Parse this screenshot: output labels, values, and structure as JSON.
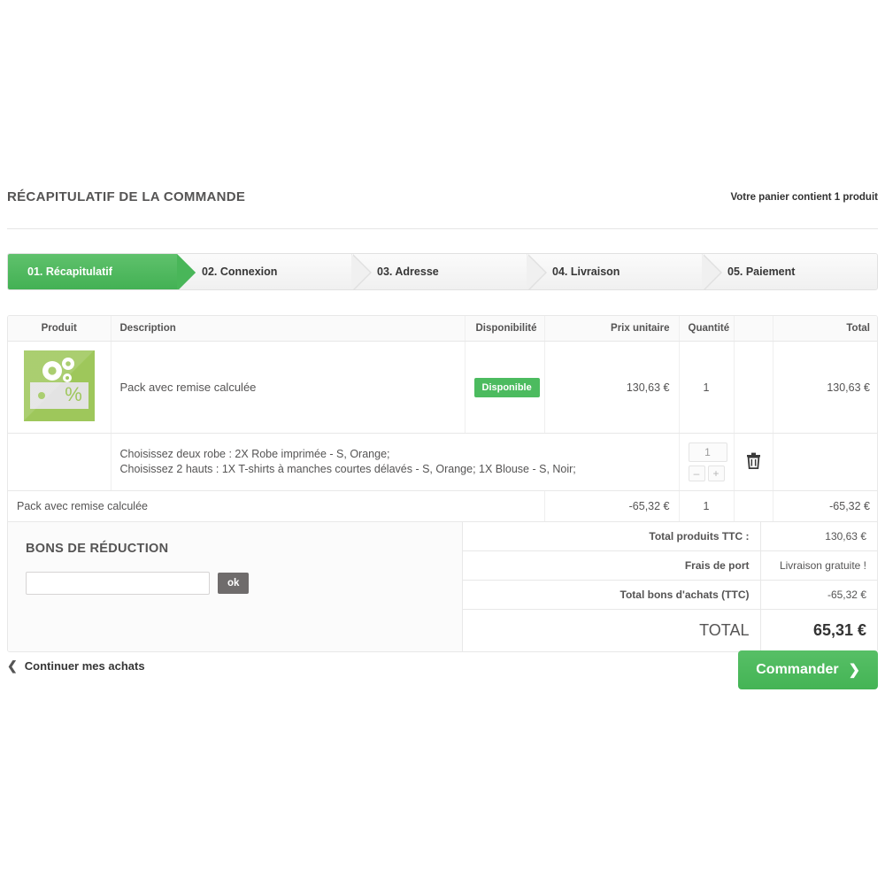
{
  "header": {
    "title": "RÉCAPITULATIF DE LA COMMANDE",
    "cart_summary": "Votre panier contient 1 produit"
  },
  "steps": [
    {
      "label": "01. Récapitulatif",
      "active": true
    },
    {
      "label": "02. Connexion",
      "active": false
    },
    {
      "label": "03. Adresse",
      "active": false
    },
    {
      "label": "04. Livraison",
      "active": false
    },
    {
      "label": "05. Paiement",
      "active": false
    }
  ],
  "cart": {
    "columns": {
      "produit": "Produit",
      "description": "Description",
      "disponibilite": "Disponibilité",
      "prix_unitaire": "Prix unitaire",
      "quantite": "Quantité",
      "blank": "",
      "total": "Total"
    },
    "product": {
      "name": "Pack avec remise calculée",
      "availability": "Disponible",
      "unit_price": "130,63 €",
      "quantity": "1",
      "total": "130,63 €",
      "thumb_percent": "%"
    },
    "options": {
      "line1": "Choisissez deux robe : 2X Robe imprimée - S, Orange;",
      "line2": "Choisissez 2 hauts : 1X T-shirts à manches courtes délavés - S, Orange; 1X Blouse - S, Noir;",
      "qty_value": "1",
      "minus_label": "–",
      "plus_label": "+"
    },
    "discount_row": {
      "label": "Pack avec remise calculée",
      "unit_price": "-65,32 €",
      "quantity": "1",
      "total": "-65,32 €"
    }
  },
  "coupon": {
    "title": "BONS DE RÉDUCTION",
    "input_value": "",
    "input_placeholder": "",
    "submit_label": "ok"
  },
  "totals": [
    {
      "label": "Total produits TTC :",
      "value": "130,63 €"
    },
    {
      "label": "Frais de port",
      "value": "Livraison gratuite !"
    },
    {
      "label": "Total bons d'achats (TTC)",
      "value": "-65,32 €"
    }
  ],
  "grand_total": {
    "label": "TOTAL",
    "value": "65,31 €"
  },
  "actions": {
    "continue_label": "Continuer mes achats",
    "order_label": "Commander"
  },
  "colors": {
    "accent_green": "#4cbb5f",
    "step_green": "#49b659",
    "thumb_green": "#9ec75b",
    "ok_gray": "#6f6c6c"
  }
}
